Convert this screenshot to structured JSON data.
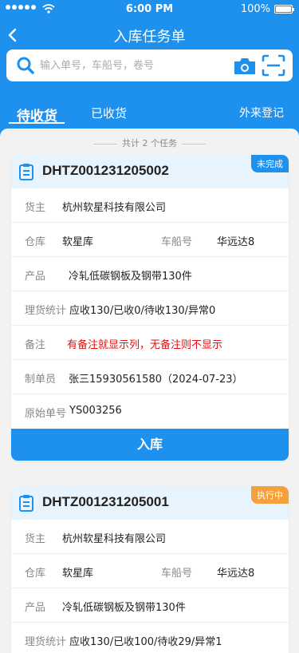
{
  "status_bar": {
    "time": "6:00 PM",
    "battery": "100%"
  },
  "header": {
    "title": "入库任务单"
  },
  "search": {
    "placeholder": "输入单号，车船号，卷号"
  },
  "tabs": [
    {
      "label": "待收货",
      "active": true
    },
    {
      "label": "已收货",
      "active": false
    },
    {
      "label": "外来登记",
      "active": false
    }
  ],
  "summary": {
    "total_text": "共计 2 个任务"
  },
  "labels": {
    "owner": "货主",
    "warehouse": "仓库",
    "vehicle": "车船号",
    "product": "产品",
    "stats": "理货统计",
    "remark": "备注",
    "creator": "制单员",
    "origin": "原始单号"
  },
  "orders": [
    {
      "code": "DHTZ001231205002",
      "status": "未完成",
      "status_color": "#1e90ee",
      "owner": "杭州软星科技有限公司",
      "warehouse": "软星库",
      "vehicle": "华远达8",
      "product": "冷轧低碳钢板及钢带130件",
      "stats": "应收130/已收0/待收130/异常0",
      "remark": "有备注就显示列，无备注则不显示",
      "creator": "张三15930561580（2024-07-23）",
      "origin": "YS003256",
      "action": "入库"
    },
    {
      "code": "DHTZ001231205001",
      "status": "执行中",
      "status_color": "#f5a03a",
      "owner": "杭州软星科技有限公司",
      "warehouse": "软星库",
      "vehicle": "华远达8",
      "product": "冷轧低碳钢板及钢带130件",
      "stats": "应收130/已收100/待收29/异常1"
    }
  ],
  "colors": {
    "primary": "#1e90ee",
    "warning": "#f5a03a",
    "remark": "#e01010"
  }
}
